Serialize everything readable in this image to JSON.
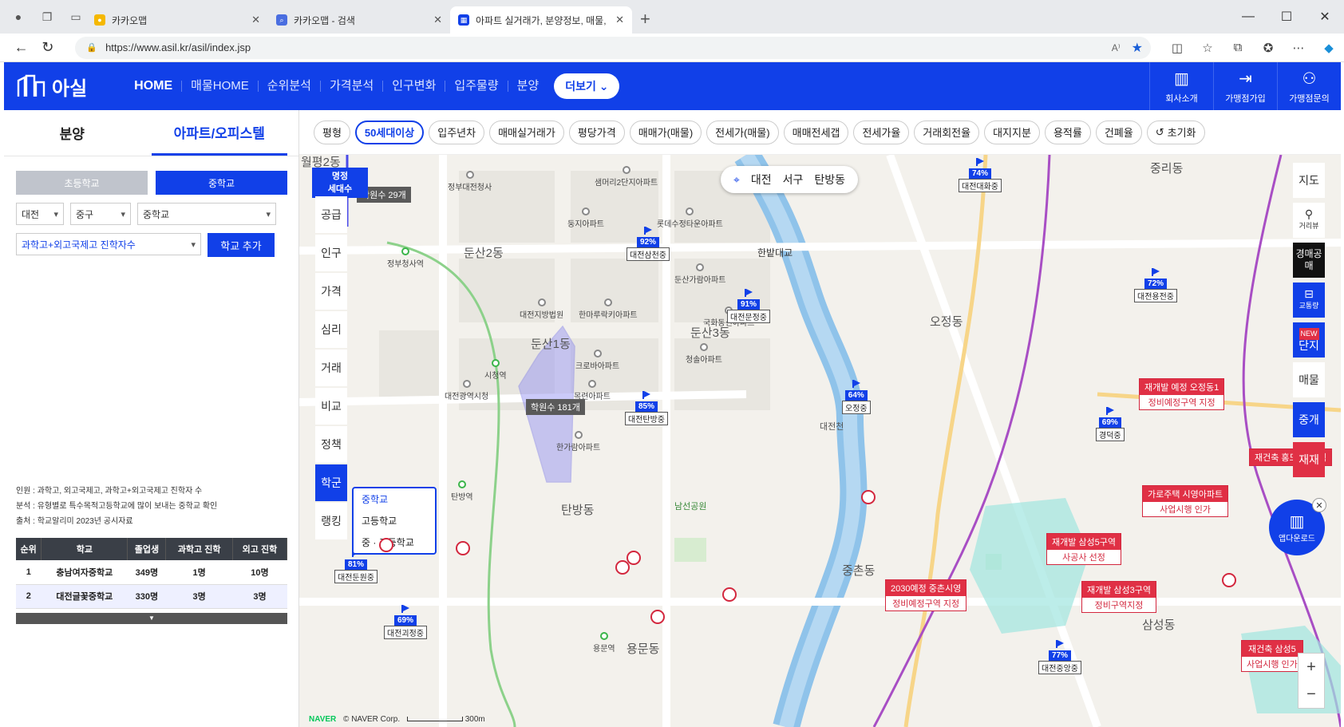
{
  "browser": {
    "tabs": [
      {
        "title": "카카오맵",
        "color": "#f5b800"
      },
      {
        "title": "카카오맵 - 검색",
        "color": "#4a6ee0"
      },
      {
        "title": "아파트 실거래가, 분양정보, 매물,",
        "color": "#1140e8"
      }
    ],
    "url": "https://www.asil.kr/asil/index.jsp"
  },
  "header": {
    "logo_text": "아실",
    "nav": [
      "HOME",
      "매물HOME",
      "순위분석",
      "가격분석",
      "인구변화",
      "입주물량",
      "분양"
    ],
    "more": "더보기",
    "right_buttons": [
      "회사소개",
      "가맹점가입",
      "가맹점문의"
    ]
  },
  "left": {
    "tabs": [
      "분양",
      "아파트/오피스텔"
    ],
    "school_types": [
      "초등학교",
      "중학교"
    ],
    "selects": [
      "대전",
      "중구",
      "중학교"
    ],
    "metric_select": "과학고+외고국제고 진학자수",
    "add_button": "학교 추가",
    "notes": [
      "인원 : 과학고, 외고국제고, 과학고+외고국제고 진학자 수",
      "분석 : 유형별로 특수목적고등학교에 많이 보내는 중학교 확인",
      "출처 : 학교알리미 2023년 공시자료"
    ],
    "table": {
      "headers": [
        "순위",
        "학교",
        "졸업생",
        "과학고 진학",
        "외고 진학"
      ],
      "rows": [
        [
          "1",
          "충남여자중학교",
          "349명",
          "1명",
          "10명"
        ],
        [
          "2",
          "대전글꽃중학교",
          "330명",
          "3명",
          "3명"
        ]
      ],
      "more_icon": "▼"
    }
  },
  "filters": [
    "평형",
    "50세대이상",
    "입주년차",
    "매매실거래가",
    "평당가격",
    "매매가(매물)",
    "전세가(매물)",
    "매매전세갭",
    "전세가율",
    "거래회전율",
    "대지지분",
    "용적률",
    "건폐율",
    "초기화"
  ],
  "map": {
    "location": [
      "대전",
      "서구",
      "탄방동"
    ],
    "side_menu": [
      "공급",
      "인구",
      "가격",
      "심리",
      "거래",
      "비교",
      "정책",
      "학군",
      "랭킹"
    ],
    "school_dropdown": [
      "중학교",
      "고등학교",
      "중 · 고등학교"
    ],
    "myung_badge": [
      "명정",
      "세대수"
    ],
    "academy_counts": [
      "학원수 29개",
      "학원수 181개"
    ],
    "area_labels": [
      "월평2동",
      "둔산2동",
      "둔산1동",
      "둔산3동",
      "오정동",
      "중촌동",
      "중리동",
      "용문동",
      "탄방동",
      "삼성동"
    ],
    "poi": [
      "정부대전청사",
      "샘머리2단지아파트",
      "둥지아파트",
      "롯데수정타운아파트",
      "둔산가람아파트",
      "국화동신아파트",
      "청솔아파트",
      "한마루락키아파트",
      "대전지방법원",
      "크로바아파트",
      "목련아파트",
      "한가람아파트",
      "대전광역시청",
      "정부청사역",
      "시청역",
      "탄방역",
      "용문역",
      "한밭대교",
      "대전천",
      "남선공원"
    ],
    "flags": [
      {
        "pct": "74%",
        "name": "대전대화중"
      },
      {
        "pct": "92%",
        "name": "대전삼천중"
      },
      {
        "pct": "91%",
        "name": "대전문정중"
      },
      {
        "pct": "85%",
        "name": "대전탄방중"
      },
      {
        "pct": "64%",
        "name": "오정중"
      },
      {
        "pct": "72%",
        "name": "대전용전중"
      },
      {
        "pct": "69%",
        "name": "경덕중"
      },
      {
        "pct": "81%",
        "name": "대전둔원중"
      },
      {
        "pct": "69%",
        "name": "대전괴정중"
      },
      {
        "pct": "77%",
        "name": "대전중앙중"
      }
    ],
    "redev": [
      {
        "a": "재개발 예정 오정동1",
        "b": "정비예정구역 지정"
      },
      {
        "a": "가로주택 시영아파트",
        "b": "사업시행 인가"
      },
      {
        "a": "재개발 삼성5구역",
        "b": "사공사 선정"
      },
      {
        "a": "2030예정 중촌시영",
        "b": "정비예정구역 지정"
      },
      {
        "a": "재개발 삼성3구역",
        "b": "정비구역지정"
      },
      {
        "a": "재건축 삼성5",
        "b": "사업시행 인가"
      },
      {
        "a": "재건축 홍도동2구역",
        "b": ""
      }
    ],
    "right_tools": [
      "지도",
      "거리뷰",
      "경매공매",
      "교통량",
      "단지",
      "매물",
      "중개",
      "재재"
    ],
    "new_badge": "NEW",
    "app_download": "앱다운로드",
    "naver_text": "NAVER",
    "copyright": "© NAVER Corp.",
    "scale": "300m"
  }
}
